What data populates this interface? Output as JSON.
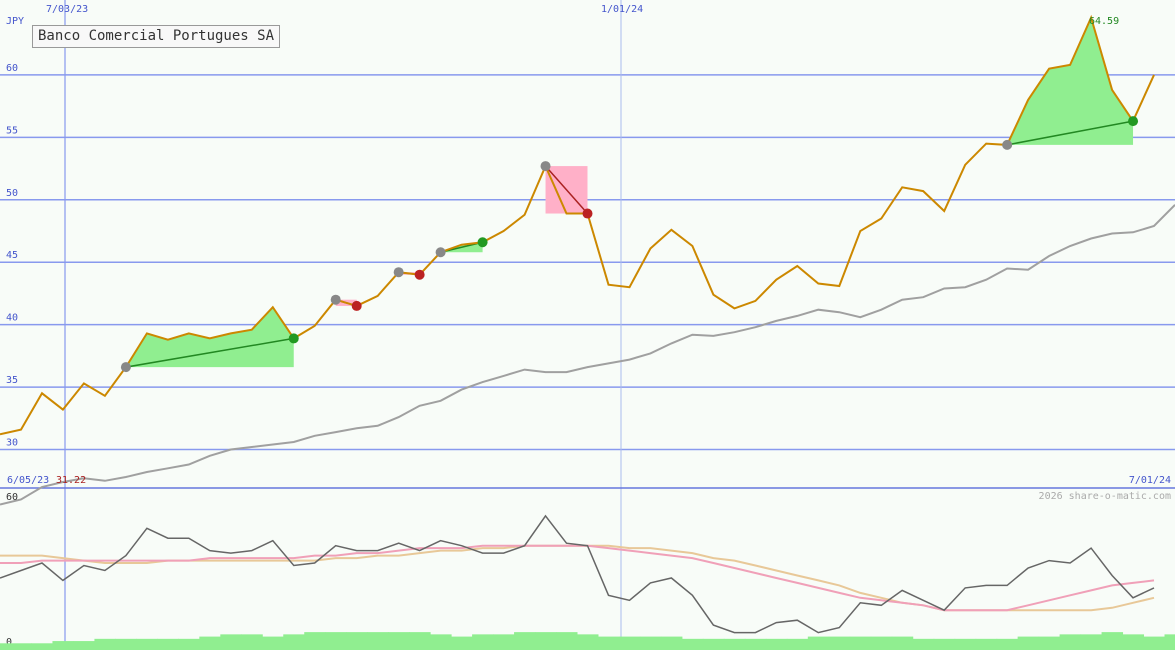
{
  "chart_data": [
    {
      "type": "line",
      "title": "Banco Comercial Portugues SA",
      "currency_label": "JPY",
      "ylim": [
        27,
        66
      ],
      "y_ticks": [
        30,
        35,
        40,
        45,
        50,
        55,
        60
      ],
      "x_date_labels": [
        "7/03/23",
        "1/01/24"
      ],
      "start_date_label": "6/05/23",
      "start_value_label": "31.22",
      "end_date_label": "7/01/24",
      "peak_label": "64.59",
      "copyright": "2026 share-o-matic.com",
      "weeks": 57,
      "series": [
        {
          "values": [
            31.22,
            31.6,
            34.5,
            33.2,
            35.3,
            34.3,
            36.6,
            39.3,
            38.8,
            39.3,
            38.9,
            39.3,
            39.6,
            41.4,
            38.9,
            39.9,
            42.0,
            41.5,
            42.3,
            44.2,
            44.0,
            45.8,
            46.4,
            46.6,
            47.5,
            48.8,
            52.7,
            48.9,
            48.9,
            43.2,
            43.0,
            46.1,
            47.6,
            46.3,
            42.4,
            41.3,
            41.9,
            43.6,
            44.7,
            43.3,
            43.1,
            47.5,
            48.5,
            51.0,
            50.7,
            49.1,
            52.8,
            54.5,
            54.4,
            58.0,
            60.5,
            60.8,
            64.59,
            58.8,
            56.3,
            60.0
          ]
        },
        {
          "name": "moving-average",
          "values": [
            25.6,
            26.0,
            27.0,
            27.4,
            27.7,
            27.5,
            27.8,
            28.2,
            28.5,
            28.8,
            29.5,
            30.0,
            30.2,
            30.4,
            30.6,
            31.1,
            31.4,
            31.7,
            31.9,
            32.6,
            33.5,
            33.9,
            34.8,
            35.4,
            35.9,
            36.4,
            36.2,
            36.2,
            36.6,
            36.9,
            37.2,
            37.7,
            38.5,
            39.2,
            39.1,
            39.4,
            39.8,
            40.3,
            40.7,
            41.2,
            41.0,
            40.6,
            41.2,
            42.0,
            42.2,
            42.9,
            43.0,
            43.6,
            44.5,
            44.4,
            45.5,
            46.3,
            46.9,
            47.3,
            47.4,
            47.9,
            49.6
          ]
        }
      ],
      "trades": [
        {
          "entry_week": 6,
          "entry": 36.6,
          "exit_week": 14,
          "exit": 38.9,
          "result": "gain"
        },
        {
          "entry_week": 16,
          "entry": 42.0,
          "exit_week": 17,
          "exit": 41.5,
          "result": "loss"
        },
        {
          "entry_week": 19,
          "entry": 44.2,
          "exit_week": 20,
          "exit": 44.0,
          "result": "loss"
        },
        {
          "entry_week": 21,
          "entry": 45.8,
          "exit_week": 23,
          "exit": 46.6,
          "result": "gain"
        },
        {
          "entry_week": 26,
          "entry": 52.7,
          "exit_week": 28,
          "exit": 48.9,
          "result": "loss"
        },
        {
          "entry_week": 48,
          "entry": 54.4,
          "exit_week": 54,
          "exit": 56.3,
          "result": "gain"
        }
      ]
    },
    {
      "type": "line",
      "ylim": [
        0,
        60
      ],
      "y_ticks": [
        0,
        60
      ],
      "series": [
        {
          "name": "oscillator",
          "values": [
            27,
            30,
            33,
            26,
            32,
            30,
            36,
            47,
            43,
            43,
            38,
            37,
            38,
            42,
            32,
            33,
            40,
            38,
            38,
            41,
            38,
            42,
            40,
            37,
            37,
            40,
            52,
            41,
            40,
            20,
            18,
            25,
            27,
            20,
            8,
            5,
            5,
            9,
            10,
            5,
            7,
            17,
            16,
            22,
            18,
            14,
            23,
            24,
            24,
            31,
            34,
            33,
            39,
            28,
            19,
            23
          ]
        },
        {
          "name": "moving-average-1",
          "values": [
            33,
            33,
            34,
            34,
            34,
            34,
            34,
            34,
            34,
            34,
            35,
            35,
            35,
            35,
            35,
            36,
            36,
            37,
            37,
            38,
            39,
            39,
            39,
            40,
            40,
            40,
            40,
            40,
            40,
            39,
            38,
            37,
            36,
            35,
            33,
            31,
            29,
            27,
            25,
            23,
            21,
            19,
            18,
            17,
            16,
            14,
            14,
            14,
            14,
            16,
            18,
            20,
            22,
            24,
            25,
            26
          ]
        },
        {
          "name": "moving-average-2",
          "values": [
            36,
            36,
            36,
            35,
            34,
            33,
            33,
            33,
            34,
            34,
            34,
            34,
            34,
            34,
            34,
            34,
            35,
            35,
            36,
            36,
            37,
            38,
            38,
            39,
            39,
            40,
            40,
            40,
            40,
            40,
            39,
            39,
            38,
            37,
            35,
            34,
            32,
            30,
            28,
            26,
            24,
            21,
            19,
            17,
            16,
            14,
            14,
            14,
            14,
            14,
            14,
            14,
            14,
            15,
            17,
            19
          ]
        },
        {
          "name": "volume",
          "values": [
            3,
            3,
            3,
            4,
            4,
            5,
            5,
            5,
            5,
            5,
            6,
            7,
            7,
            6,
            7,
            8,
            8,
            8,
            8,
            8,
            8,
            7,
            6,
            7,
            7,
            8,
            8,
            8,
            7,
            6,
            6,
            6,
            6,
            5,
            5,
            5,
            5,
            5,
            5,
            6,
            6,
            6,
            6,
            6,
            5,
            5,
            5,
            5,
            5,
            6,
            6,
            7,
            7,
            8,
            7,
            6,
            7
          ]
        }
      ]
    }
  ]
}
